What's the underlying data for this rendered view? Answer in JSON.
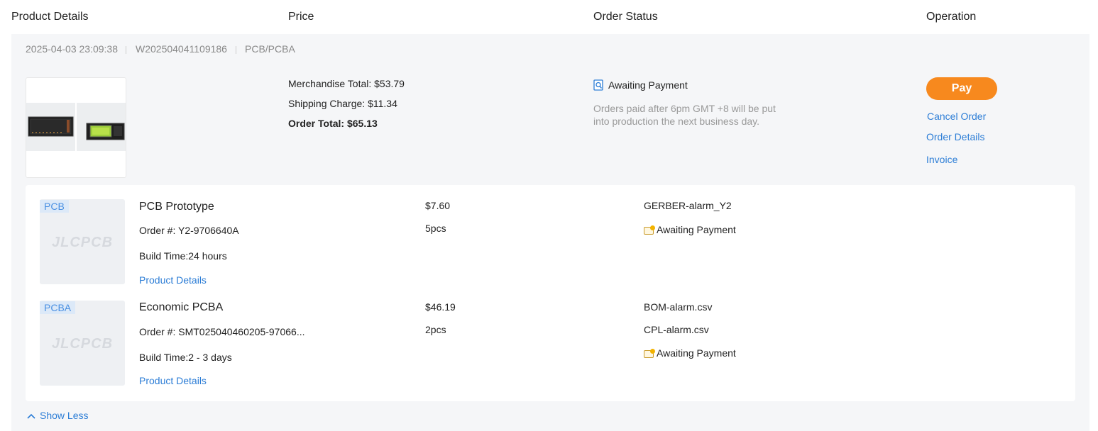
{
  "header": {
    "product_details": "Product Details",
    "price": "Price",
    "order_status": "Order Status",
    "operation": "Operation"
  },
  "order": {
    "date": "2025-04-03 23:09:38",
    "order_id": "W202504041109186",
    "category": "PCB/PCBA",
    "merchandise_total": "Merchandise Total: $53.79",
    "shipping_charge": "Shipping Charge: $11.34",
    "order_total": "Order Total: $65.13",
    "status": "Awaiting Payment",
    "status_note": "Orders paid after 6pm GMT +8 will be put into production the next business day.",
    "actions": {
      "pay": "Pay",
      "cancel": "Cancel Order",
      "details": "Order Details",
      "invoice": "Invoice"
    }
  },
  "items": [
    {
      "tag": "PCB",
      "placeholder": "JLCPCB",
      "title": "PCB Prototype",
      "order_no": "Order #: Y2-9706640A",
      "build_time": "Build Time:24 hours",
      "link": "Product Details",
      "price": "$7.60",
      "qty": "5pcs",
      "files": [
        "GERBER-alarm_Y2"
      ],
      "status": "Awaiting Payment"
    },
    {
      "tag": "PCBA",
      "placeholder": "JLCPCB",
      "title": "Economic PCBA",
      "order_no": "Order #: SMT025040460205-97066...",
      "build_time": "Build Time:2 - 3 days",
      "link": "Product Details",
      "price": "$46.19",
      "qty": "2pcs",
      "files": [
        "BOM-alarm.csv",
        "CPL-alarm.csv"
      ],
      "status": "Awaiting Payment"
    }
  ],
  "toggle": {
    "label": "Show Less",
    "icon": "chevron-up-icon"
  },
  "colors": {
    "accent": "#f7891e",
    "link": "#2c7dd6",
    "panel": "#f5f6f8"
  }
}
